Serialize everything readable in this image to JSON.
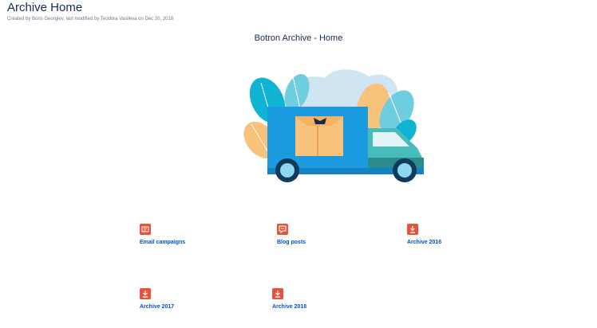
{
  "page": {
    "title": "Archive Home",
    "byline_prefix": "Created by",
    "creator": "Boris Georgiev",
    "byline_middle": ", last modified by",
    "modifier": "Teodora Vasileva",
    "byline_on": "on",
    "modified_date": "Dec 20, 2018"
  },
  "content": {
    "heading": "Botron Archive - Home"
  },
  "links": [
    {
      "label": "Email campaigns",
      "icon": "email-campaign-icon"
    },
    {
      "label": "Blog posts",
      "icon": "chat-bubble-icon"
    },
    {
      "label": "Archive 2016",
      "icon": "archive-download-icon"
    },
    {
      "label": "Archive 2017",
      "icon": "archive-download-icon"
    },
    {
      "label": "Archive 2018",
      "icon": "archive-download-icon"
    }
  ],
  "colors": {
    "link": "#0052cc",
    "icon_bg": "#e5533d",
    "truck_blue": "#1a9be0",
    "truck_teal": "#2a8c8c",
    "box": "#f7c37b"
  }
}
